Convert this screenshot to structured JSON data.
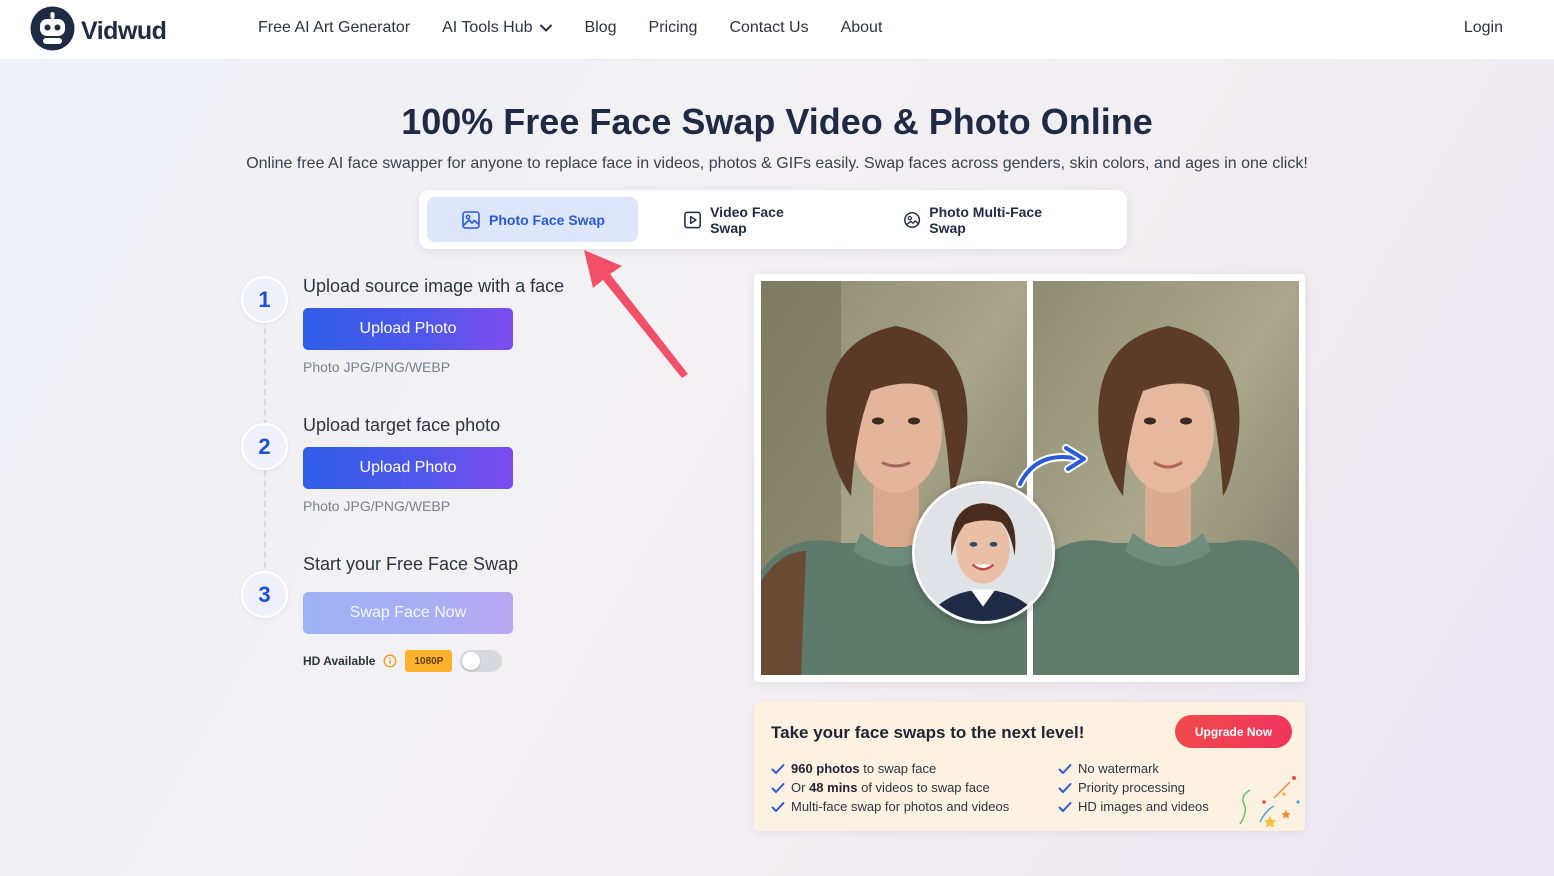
{
  "brand": {
    "name": "Vidwud"
  },
  "nav": {
    "items": [
      {
        "label": "Free AI Art Generator"
      },
      {
        "label": "AI Tools Hub"
      },
      {
        "label": "Blog"
      },
      {
        "label": "Pricing"
      },
      {
        "label": "Contact Us"
      },
      {
        "label": "About"
      }
    ],
    "login": "Login"
  },
  "hero": {
    "title": "100% Free Face Swap Video & Photo Online",
    "subtitle": "Online free AI face swapper for anyone to replace face in videos, photos & GIFs easily. Swap faces across genders, skin colors, and ages in one click!"
  },
  "tabs": [
    {
      "label": "Photo Face Swap",
      "icon": "image-icon",
      "active": true
    },
    {
      "label": "Video Face Swap",
      "icon": "video-icon",
      "active": false
    },
    {
      "label": "Photo Multi-Face Swap",
      "icon": "multi-face-icon",
      "active": false
    }
  ],
  "steps": [
    {
      "number": "1",
      "title": "Upload source image with a face",
      "button": "Upload Photo",
      "hint": "Photo JPG/PNG/WEBP"
    },
    {
      "number": "2",
      "title": "Upload target face photo",
      "button": "Upload Photo",
      "hint": "Photo JPG/PNG/WEBP"
    },
    {
      "number": "3",
      "title": "Start your Free Face Swap",
      "button": "Swap Face Now"
    }
  ],
  "hd": {
    "label": "HD Available",
    "badge": "1080P",
    "enabled": false
  },
  "upgrade": {
    "title": "Take your face swaps to the next level!",
    "button": "Upgrade Now",
    "features_left": [
      {
        "bold": "960 photos",
        "text": " to swap face",
        "prefix": ""
      },
      {
        "prefix": "Or ",
        "bold": "48 mins",
        "text": " of videos to swap face"
      },
      {
        "prefix": "Multi-face swap for photos and videos",
        "bold": "",
        "text": ""
      }
    ],
    "features_right": [
      {
        "text": "No watermark"
      },
      {
        "text": "Priority processing"
      },
      {
        "text": "HD images and videos"
      }
    ]
  },
  "colors": {
    "primary": "#2f5ee8",
    "accent_purple": "#7e4cf0",
    "active_tab_bg": "#dde6fb",
    "upgrade_bg": "#fdf2e1",
    "upgrade_button": "#ef4a4a",
    "badge": "#ffb22b",
    "pointer_arrow": "#f25068"
  }
}
